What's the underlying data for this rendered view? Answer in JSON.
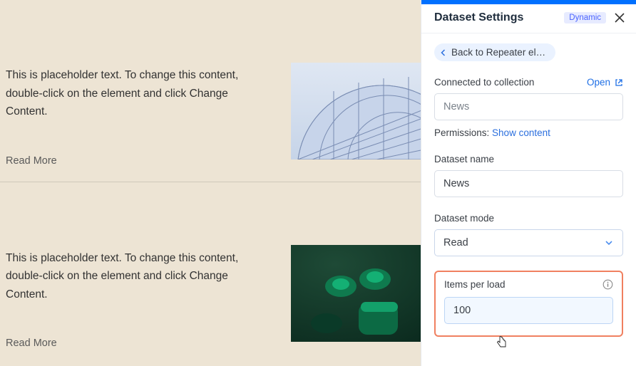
{
  "canvas": {
    "items": [
      {
        "text": "This is placeholder text. To change this content, double-click on the element and click Change Content.",
        "link": "Read More"
      },
      {
        "text": "This is placeholder text. To change this content, double-click on the element and click Change Content.",
        "link": "Read More"
      }
    ]
  },
  "panel": {
    "title": "Dataset Settings",
    "badge": "Dynamic",
    "back_label": "Back to Repeater ele…",
    "connected": {
      "label": "Connected to collection",
      "open": "Open",
      "value": "News"
    },
    "permissions": {
      "label": "Permissions:",
      "link": "Show content"
    },
    "dataset_name": {
      "label": "Dataset name",
      "value": "News"
    },
    "dataset_mode": {
      "label": "Dataset mode",
      "value": "Read"
    },
    "items_per_load": {
      "label": "Items per load",
      "value": "100"
    }
  }
}
